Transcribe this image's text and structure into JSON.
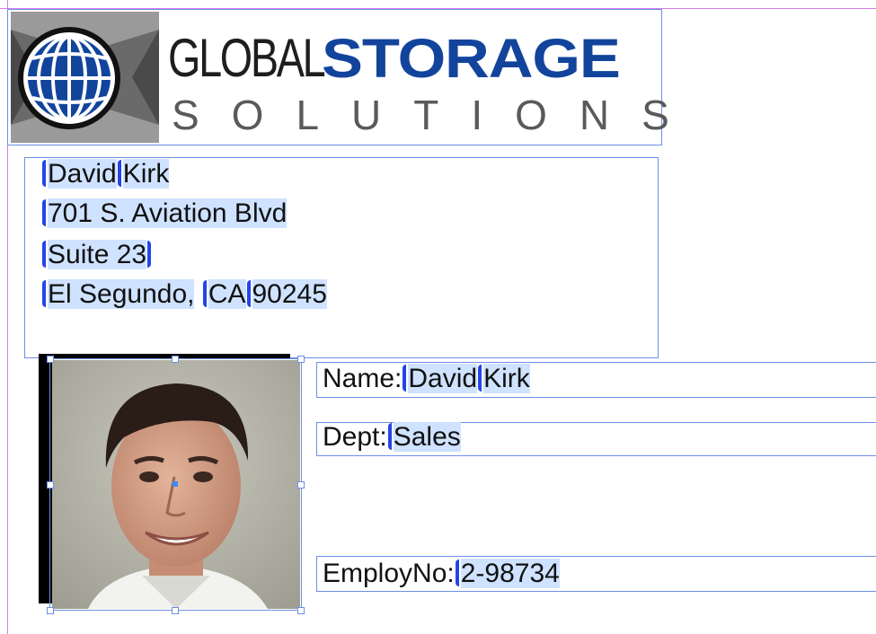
{
  "logo": {
    "word_global": "GLOBAL",
    "word_storage": "STORAGE",
    "word_solutions": "SOLUTIONS",
    "brand_blue": "#12449c",
    "emblem_icon": "globe-icon"
  },
  "address": {
    "first_name": "David",
    "last_name": "Kirk",
    "street": "701 S. Aviation Blvd",
    "suite": "Suite 23",
    "city": "El Segundo,",
    "state": "CA",
    "zip": "90245"
  },
  "fields": {
    "name_label": "Name:",
    "name_first": "David",
    "name_last": "Kirk",
    "dept_label": "Dept:",
    "dept_value": "Sales",
    "employ_label": "EmployNo:",
    "employ_value": "2-98734"
  },
  "colors": {
    "frame_stroke": "#6c8fe6",
    "guide": "#d57be6",
    "variable_highlight": "#cfe2ff",
    "marker": "#2445e8"
  }
}
